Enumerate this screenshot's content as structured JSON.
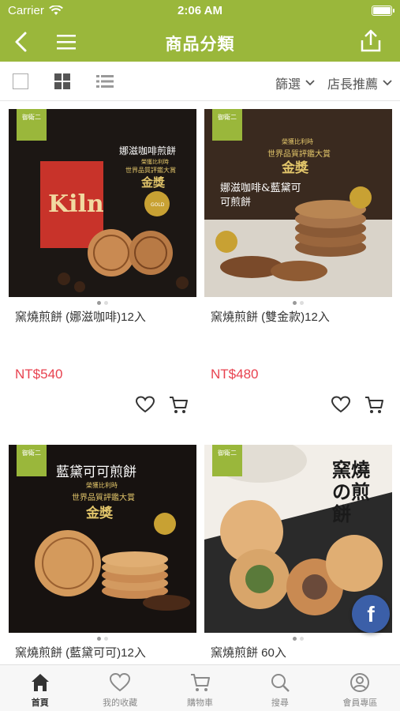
{
  "status": {
    "carrier": "Carrier",
    "time": "2:06 AM"
  },
  "nav": {
    "title": "商品分類"
  },
  "toolbar": {
    "filter_label": "篩選",
    "sort_label": "店長推薦"
  },
  "products": [
    {
      "name": "窯燒煎餅 (娜滋咖啡)12入",
      "price": "NT$540",
      "poster_text": "娜滋咖啡煎餅",
      "award_line1": "榮獲比利時",
      "award_line2": "世界品質評鑑大賞",
      "award_line3": "金獎",
      "box_text": "Kiln"
    },
    {
      "name": "窯燒煎餅 (雙金款)12入",
      "price": "NT$480",
      "poster_text": "娜滋咖啡&藍黛可可煎餅",
      "award_line1": "榮獲比利時",
      "award_line2": "世界品質評鑑大賞",
      "award_line3": "金獎"
    },
    {
      "name": "窯燒煎餅 (藍黛可可)12入",
      "price": "",
      "poster_text": "藍黛可可煎餅",
      "award_line1": "榮獲比利時",
      "award_line2": "世界品質評鑑大賞",
      "award_line3": "金獎"
    },
    {
      "name": "窯燒煎餅 60入",
      "price": "",
      "poster_text": "窯燒の煎餅"
    }
  ],
  "brand_badge": "御衛二",
  "fb_label": "f",
  "tabs": [
    {
      "label": "首頁",
      "icon": "home-icon"
    },
    {
      "label": "我的收藏",
      "icon": "heart-icon"
    },
    {
      "label": "購物車",
      "icon": "cart-icon"
    },
    {
      "label": "搜尋",
      "icon": "search-icon"
    },
    {
      "label": "會員專區",
      "icon": "user-icon"
    }
  ],
  "colors": {
    "brand": "#9ab73b",
    "price": "#e8424f",
    "facebook": "#3b5fa8"
  }
}
